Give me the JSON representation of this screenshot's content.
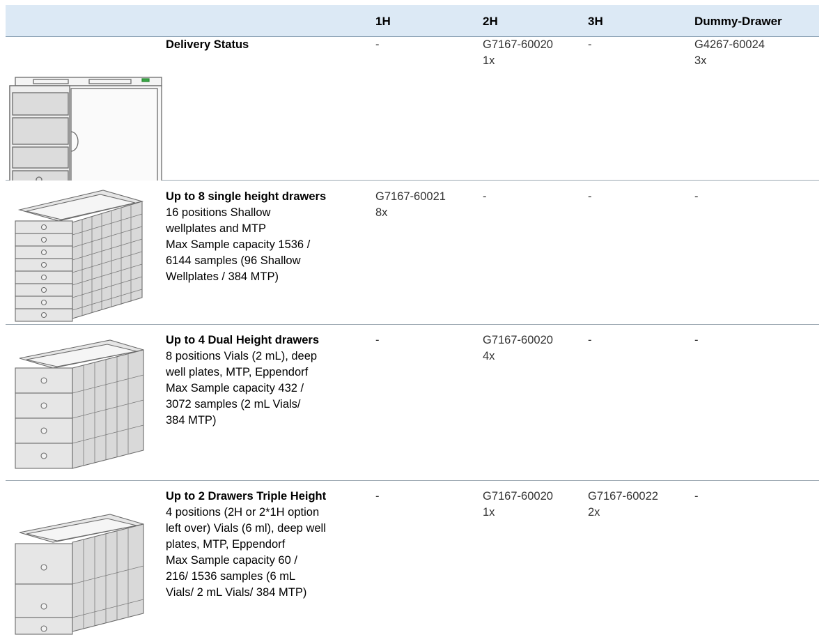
{
  "header": {
    "col_1h": "1H",
    "col_2h": "2H",
    "col_3h": "3H",
    "col_dummy": "Dummy-Drawer"
  },
  "rows": [
    {
      "title": "Delivery Status",
      "lines": [],
      "c1h": [
        "-"
      ],
      "c2h": [
        "G7167-60020",
        "1x"
      ],
      "c3h": [
        "-"
      ],
      "cdummy": [
        "G4267-60024",
        "3x"
      ],
      "image": "instrument-front-icon"
    },
    {
      "title": "Up to 8 single height drawers",
      "lines": [
        "16 positions Shallow",
        "wellplates and MTP",
        "Max Sample capacity 1536 /",
        "6144 samples (96 Shallow",
        "Wellplates / 384 MTP)"
      ],
      "c1h": [
        "G7167-60021",
        "8x"
      ],
      "c2h": [
        "-"
      ],
      "c3h": [
        "-"
      ],
      "cdummy": [
        "-"
      ],
      "image": "single-height-drawers-icon"
    },
    {
      "title": "Up to 4 Dual Height drawers",
      "lines": [
        "8 positions Vials (2 mL), deep",
        "well plates, MTP, Eppendorf",
        "Max Sample capacity 432 /",
        "3072 samples (2 mL Vials/",
        "384 MTP)"
      ],
      "c1h": [
        "-"
      ],
      "c2h": [
        "G7167-60020",
        "4x"
      ],
      "c3h": [
        "-"
      ],
      "cdummy": [
        "-"
      ],
      "image": "dual-height-drawers-icon"
    },
    {
      "title": "Up to 2 Drawers Triple Height",
      "lines": [
        "4 positions (2H or 2*1H option",
        "left over) Vials (6 ml), deep well",
        "plates, MTP, Eppendorf",
        "Max Sample capacity 60 /",
        "216/ 1536 samples (6 mL",
        "Vials/ 2 mL Vials/ 384 MTP)"
      ],
      "c1h": [
        "-"
      ],
      "c2h": [
        "G7167-60020",
        "1x"
      ],
      "c3h": [
        "G7167-60022",
        "2x"
      ],
      "cdummy": [
        "-"
      ],
      "image": "triple-height-drawers-icon"
    }
  ]
}
